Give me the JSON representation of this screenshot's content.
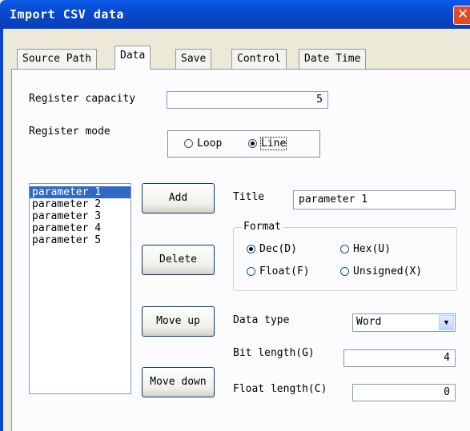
{
  "window": {
    "title": "Import CSV data"
  },
  "tabs": [
    {
      "label": "Source Path"
    },
    {
      "label": "Data"
    },
    {
      "label": "Save"
    },
    {
      "label": "Control"
    },
    {
      "label": "Date Time"
    }
  ],
  "register": {
    "capacity_label": "Register capacity",
    "capacity_value": "5",
    "mode_label": "Register mode",
    "mode_options": [
      "Loop",
      "Line"
    ],
    "mode_selected": "Line"
  },
  "parameters": [
    "parameter 1",
    "parameter 2",
    "parameter 3",
    "parameter 4",
    "parameter 5"
  ],
  "selected_parameter": "parameter 1",
  "buttons": {
    "add": "Add",
    "delete": "Delete",
    "move_up": "Move up",
    "move_down": "Move down"
  },
  "title_field": {
    "label": "Title",
    "value": "parameter 1"
  },
  "format": {
    "legend": "Format",
    "options": [
      "Dec(D)",
      "Hex(U)",
      "Float(F)",
      "Unsigned(X)"
    ],
    "selected": "Dec(D)"
  },
  "data_type": {
    "label": "Data type",
    "value": "Word"
  },
  "bit_length": {
    "label": "Bit length(G)",
    "value": "4"
  },
  "float_length": {
    "label": "Float length(C)",
    "value": "0"
  }
}
